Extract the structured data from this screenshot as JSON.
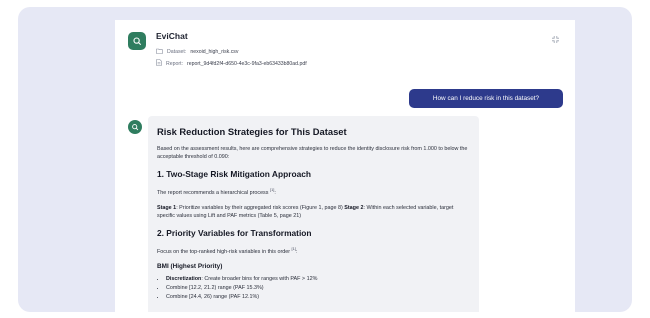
{
  "app": {
    "title": "EviChat",
    "dataset_label": "Dataset:",
    "dataset_value": "nexoid_high_risk.csv",
    "report_label": "Report:",
    "report_value": "report_9d4fd2f4-d650-4e3c-9fa3-eb63433b80ad.pdf"
  },
  "user_message": "How can I reduce risk in this dataset?",
  "answer": {
    "title": "Risk Reduction Strategies for This Dataset",
    "intro": "Based on the assessment results, here are comprehensive strategies to reduce the identity disclosure risk from 1.000 to below the acceptable threshold of 0.090:",
    "s1_heading": "1. Two-Stage Risk Mitigation Approach",
    "s1_text": "The report recommends a hierarchical process",
    "s1_cite": "[1]",
    "stage1_label": "Stage 1",
    "stage1_text": ": Prioritize variables by their aggregated risk scores (Figure 1, page 8) ",
    "stage2_label": "Stage 2",
    "stage2_text": ": Within each selected variable, target specific values using Lift and PAF metrics (Table 5, page 21)",
    "s2_heading": "2. Priority Variables for Transformation",
    "s2_text": "Focus on the top-ranked high-risk variables in this order",
    "s2_cite": "[1]",
    "bmi_heading": "BMI (Highest Priority)",
    "bullets": [
      {
        "bold": "Discretization",
        "text": ": Create broader bins for ranges with PAF > 12%"
      },
      {
        "text": "Combine [12.2, 21.2) range (PAF 15.3%)"
      },
      {
        "text": "Combine [24.4, 26) range (PAF 12.1%)"
      }
    ]
  },
  "colors": {
    "accent": "#2d3a8c",
    "brand": "#2f7d5f",
    "frame_bg": "#e6e8f5",
    "answer_bg": "#f1f2f5"
  },
  "icons": {
    "app_logo": "chat-icon",
    "dataset": "folder-icon",
    "report": "document-icon",
    "collapse": "collapse-icon",
    "bot": "bot-icon"
  }
}
